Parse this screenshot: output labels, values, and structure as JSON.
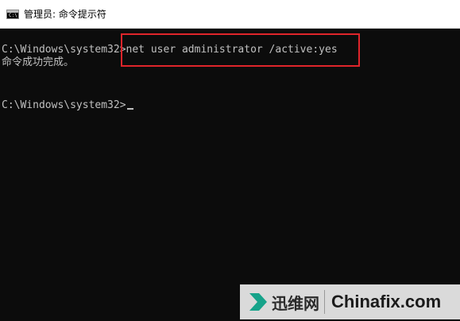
{
  "window": {
    "icon": "cmd-icon",
    "icon_text": "C:\\",
    "title": "管理员: 命令提示符"
  },
  "console": {
    "lines": [
      "C:\\Windows\\system32>net user administrator /active:yes",
      "命令成功完成。",
      "",
      "C:\\Windows\\system32>"
    ]
  },
  "colors": {
    "background": "#0c0c0c",
    "text": "#c0c0c0",
    "highlight_box": "#e0252b"
  },
  "watermark": {
    "icon": "arrow-logo-icon",
    "cn": "迅维网",
    "en": "Chinafix.com"
  }
}
